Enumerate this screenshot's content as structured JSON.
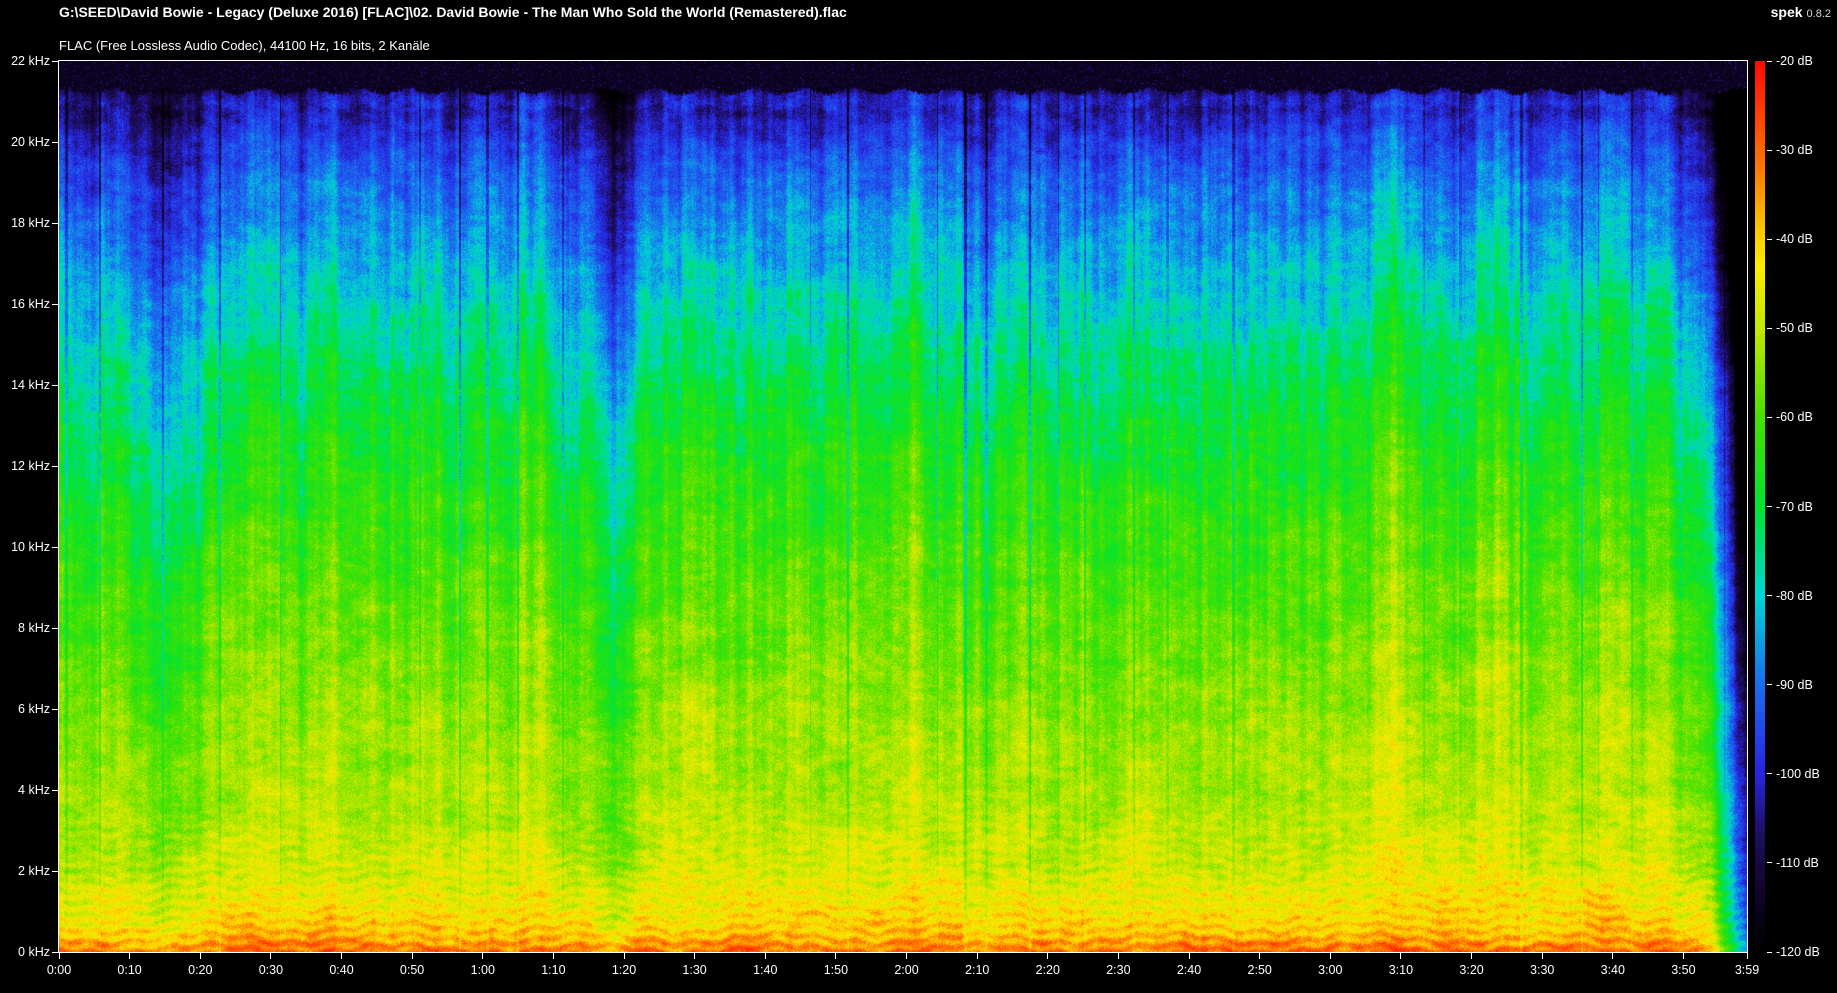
{
  "window": {
    "title": "G:\\SEED\\David Bowie - Legacy (Deluxe 2016) [FLAC]\\02. David Bowie - The Man Who Sold the World (Remastered).flac",
    "app_name": "spek",
    "app_version": "0.8.2"
  },
  "file_info": "FLAC (Free Lossless Audio Codec), 44100 Hz, 16 bits, 2 Kanäle",
  "chart_data": {
    "type": "heatmap",
    "subtype": "audio-spectrogram",
    "title": "G:\\SEED\\David Bowie - Legacy (Deluxe 2016) [FLAC]\\02. David Bowie - The Man Who Sold the World (Remastered).flac",
    "subtitle": "FLAC (Free Lossless Audio Codec), 44100 Hz, 16 bits, 2 Kanäle",
    "x_axis": {
      "label": "time",
      "duration_seconds": 239,
      "tick_seconds": [
        0,
        10,
        20,
        30,
        40,
        50,
        60,
        70,
        80,
        90,
        100,
        110,
        120,
        130,
        140,
        150,
        160,
        170,
        180,
        190,
        200,
        210,
        220,
        230,
        239
      ],
      "tick_labels": [
        "0:00",
        "0:10",
        "0:20",
        "0:30",
        "0:40",
        "0:50",
        "1:00",
        "1:10",
        "1:20",
        "1:30",
        "1:40",
        "1:50",
        "2:00",
        "2:10",
        "2:20",
        "2:30",
        "2:40",
        "2:50",
        "3:00",
        "3:10",
        "3:20",
        "3:30",
        "3:40",
        "3:50",
        "3:59"
      ]
    },
    "y_axis": {
      "label": "frequency",
      "max_khz": 22,
      "tick_khz": [
        22,
        20,
        18,
        16,
        14,
        12,
        10,
        8,
        6,
        4,
        2,
        0
      ],
      "tick_labels": [
        "22 kHz",
        "20 kHz",
        "18 kHz",
        "16 kHz",
        "14 kHz",
        "12 kHz",
        "10 kHz",
        "8 kHz",
        "6 kHz",
        "4 kHz",
        "2 kHz",
        "0 kHz"
      ]
    },
    "color_scale": {
      "label": "level",
      "tick_db": [
        -20,
        -30,
        -40,
        -50,
        -60,
        -70,
        -80,
        -90,
        -100,
        -110,
        -120
      ],
      "tick_labels": [
        "-20 dB",
        "-30 dB",
        "-40 dB",
        "-50 dB",
        "-60 dB",
        "-70 dB",
        "-80 dB",
        "-90 dB",
        "-100 dB",
        "-110 dB",
        "-120 dB"
      ],
      "range_db": [
        -120,
        -20
      ],
      "palette": [
        [
          0.0,
          0,
          0,
          0
        ],
        [
          0.07,
          18,
          4,
          46
        ],
        [
          0.13,
          30,
          14,
          94
        ],
        [
          0.2,
          40,
          36,
          228
        ],
        [
          0.3,
          26,
          110,
          240
        ],
        [
          0.4,
          0,
          214,
          214
        ],
        [
          0.5,
          0,
          228,
          45
        ],
        [
          0.6,
          70,
          225,
          0
        ],
        [
          0.7,
          195,
          232,
          0
        ],
        [
          0.77,
          255,
          235,
          0
        ],
        [
          0.81,
          255,
          200,
          0
        ],
        [
          0.88,
          255,
          120,
          0
        ],
        [
          1.0,
          255,
          10,
          0
        ]
      ]
    },
    "lowpass_cutoff_khz": 21.27,
    "spectral_profile_db": [
      [
        0,
        -31
      ],
      [
        0.2,
        -35
      ],
      [
        0.5,
        -40
      ],
      [
        0.9,
        -43
      ],
      [
        1.3,
        -45
      ],
      [
        2,
        -48
      ],
      [
        3,
        -51
      ],
      [
        4,
        -53
      ],
      [
        5.5,
        -55
      ],
      [
        7,
        -57.5
      ],
      [
        8.5,
        -60
      ],
      [
        10,
        -63
      ],
      [
        11.5,
        -66.5
      ],
      [
        13,
        -70.5
      ],
      [
        14.5,
        -75.5
      ],
      [
        16,
        -81
      ],
      [
        17.5,
        -87
      ],
      [
        19,
        -93.5
      ],
      [
        20,
        -99
      ],
      [
        20.7,
        -104
      ],
      [
        21.1,
        -108
      ],
      [
        21.3,
        -112
      ],
      [
        22,
        -117
      ]
    ],
    "loudness_envelope_db": [
      [
        0,
        -2
      ],
      [
        4,
        -1
      ],
      [
        8,
        0
      ],
      [
        12,
        -2
      ],
      [
        13.5,
        -12
      ],
      [
        15.5,
        -12
      ],
      [
        17,
        -1
      ],
      [
        22,
        1
      ],
      [
        28,
        2.5
      ],
      [
        35,
        1
      ],
      [
        45,
        1.5
      ],
      [
        55,
        1
      ],
      [
        65,
        1.5
      ],
      [
        75,
        0
      ],
      [
        77.5,
        -11
      ],
      [
        80,
        -11
      ],
      [
        82,
        0.5
      ],
      [
        90,
        1.5
      ],
      [
        100,
        1
      ],
      [
        110,
        1.5
      ],
      [
        120,
        2
      ],
      [
        130,
        1.5
      ],
      [
        140,
        2.5
      ],
      [
        150,
        2.5
      ],
      [
        160,
        3.5
      ],
      [
        170,
        4
      ],
      [
        180,
        4.5
      ],
      [
        190,
        5
      ],
      [
        200,
        5.5
      ],
      [
        208,
        6
      ],
      [
        220,
        6
      ],
      [
        226,
        5
      ],
      [
        229,
        3
      ],
      [
        231.5,
        -4
      ],
      [
        233.5,
        -12
      ],
      [
        235,
        -22
      ],
      [
        236.5,
        -34
      ],
      [
        237.8,
        -46
      ],
      [
        239,
        -60
      ]
    ]
  },
  "layout_note": "spectrogram of full track; hot (yellow/orange) bass floor, green mids, blue highs, black above lowpass cutoff, fade-out to black at 3:52-3:59"
}
